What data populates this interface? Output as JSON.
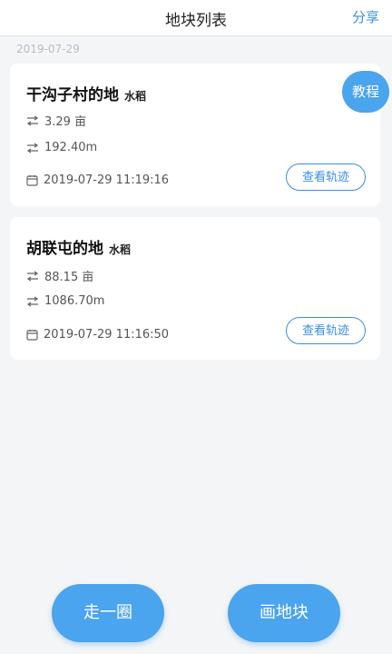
{
  "header": {
    "title": "地块列表",
    "share_label": "分享"
  },
  "date_group": "2019-07-29",
  "tutorial_label": "教程",
  "plots": [
    {
      "name": "干沟子村的地",
      "crop": "水稻",
      "area": "3.29 亩",
      "perimeter": "192.40m",
      "datetime": "2019-07-29 11:19:16",
      "track_label": "查看轨迹"
    },
    {
      "name": "胡联屯的地",
      "crop": "水稻",
      "area": "88.15 亩",
      "perimeter": "1086.70m",
      "datetime": "2019-07-29 11:16:50",
      "track_label": "查看轨迹"
    }
  ],
  "actions": {
    "walk_label": "走一圈",
    "draw_label": "画地块"
  },
  "colors": {
    "accent": "#4aa4ee",
    "link": "#3a8ee6",
    "background": "#f4f5f7"
  },
  "icons": {
    "area": "area-arrows-icon",
    "perimeter": "perimeter-arrows-icon",
    "datetime": "calendar-icon"
  }
}
